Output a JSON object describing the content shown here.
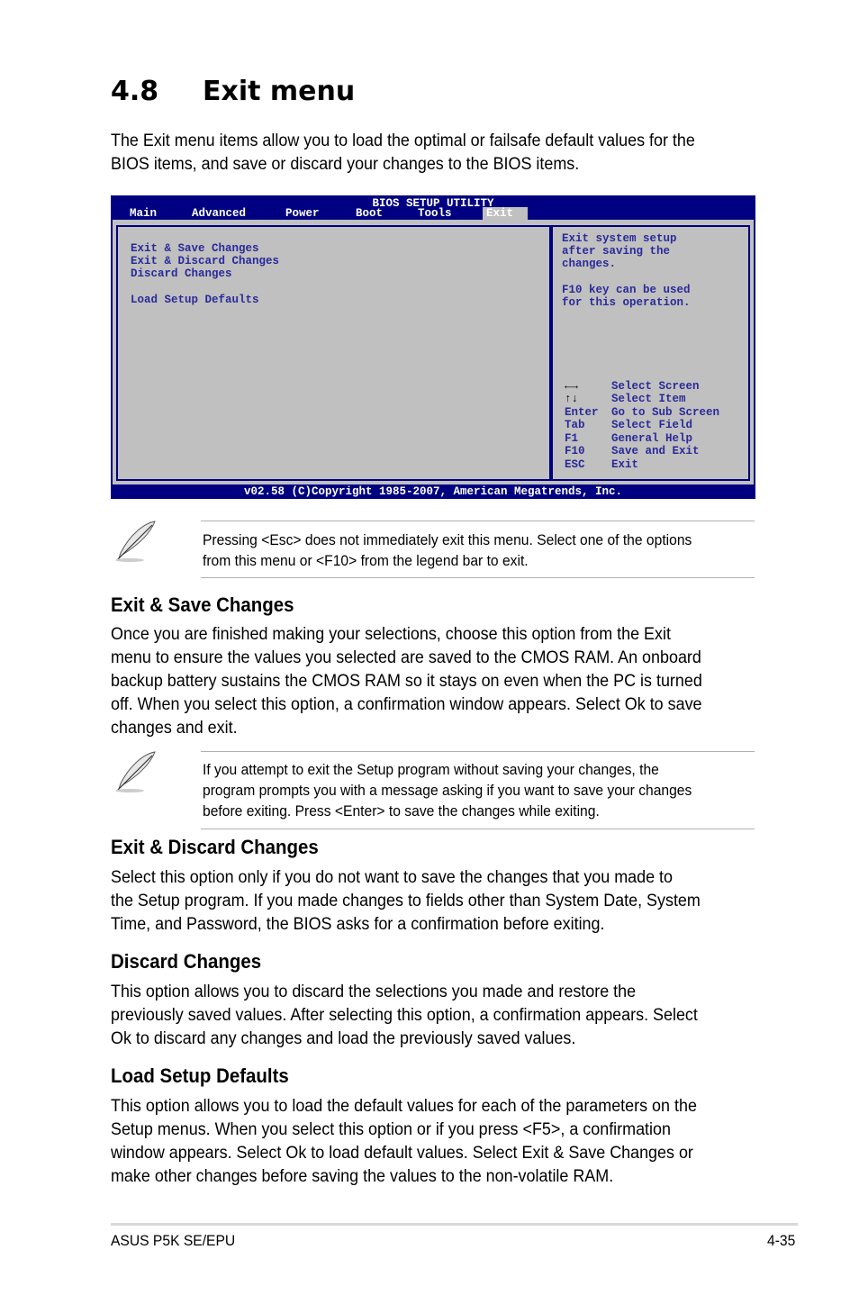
{
  "section": {
    "number": "4.8",
    "title": "Exit menu",
    "intro_lines": [
      "The Exit menu items allow you to load the optimal or failsafe default values for the",
      "BIOS items, and save or discard your changes to the BIOS items."
    ]
  },
  "bios": {
    "title": "BIOS SETUP UTILITY",
    "tabs": [
      "Main",
      "Advanced",
      "Power",
      "Boot",
      "Tools",
      "Exit"
    ],
    "active_tab": "Exit",
    "menu_items": [
      "Exit & Save Changes",
      "Exit & Discard Changes",
      "Discard Changes",
      "",
      "Load Setup Defaults"
    ],
    "help_lines": [
      "Exit system setup",
      "after saving the",
      "changes.",
      "",
      "F10 key can be used",
      "for this operation."
    ],
    "legend": [
      {
        "key": "←→",
        "action": "Select Screen"
      },
      {
        "key": "↑↓",
        "action": "Select Item"
      },
      {
        "key": "Enter",
        "action": "Go to Sub Screen"
      },
      {
        "key": "Tab",
        "action": "Select Field"
      },
      {
        "key": "F1",
        "action": "General Help"
      },
      {
        "key": "F10",
        "action": "Save and Exit"
      },
      {
        "key": "ESC",
        "action": "Exit"
      }
    ],
    "footer": "v02.58 (C)Copyright 1985-2007, American Megatrends, Inc.",
    "colors": {
      "frame": "#000080",
      "panel": "#c0c0c0",
      "text": "#2a2a9a"
    }
  },
  "notes": [
    {
      "lines": [
        "Pressing <Esc> does not immediately exit this menu. Select one of the options",
        "from this menu or <F10> from the legend bar to exit."
      ]
    },
    {
      "lines": [
        "If you attempt to exit the Setup program without saving your changes, the",
        "program prompts you with a message asking if you want to save your changes",
        "before exiting. Press <Enter>  to save the  changes while exiting."
      ]
    }
  ],
  "subsections": [
    {
      "title": "Exit & Save Changes",
      "lines": [
        "Once you are finished making your selections, choose this option from the Exit",
        "menu to ensure the values you selected are saved to the CMOS RAM. An onboard",
        "backup battery sustains the CMOS RAM so it stays on even when the PC is turned",
        "off. When you select this option, a confirmation window appears. Select Ok to save",
        "changes and exit."
      ]
    },
    {
      "title": "Exit & Discard Changes",
      "lines": [
        "Select this option only if you do not want to save the changes that you  made to",
        "the Setup program. If you made changes to fields other than System Date, System",
        "Time, and Password, the BIOS asks for a confirmation before exiting."
      ]
    },
    {
      "title": "Discard Changes",
      "lines": [
        "This option allows you to discard the selections you made and restore the",
        "previously saved values. After selecting this option, a confirmation appears. Select",
        "Ok to discard any changes and load the previously saved values."
      ]
    },
    {
      "title": "Load Setup Defaults",
      "lines": [
        "This option allows you to load the default values for each of the parameters on the",
        "Setup menus. When you select this option or if you press <F5>, a confirmation",
        "window appears. Select Ok to load default values. Select Exit & Save Changes or",
        "make other changes before saving the values to the non-volatile RAM."
      ]
    }
  ],
  "footer": {
    "left": "ASUS P5K SE/EPU",
    "right": "4-35"
  }
}
